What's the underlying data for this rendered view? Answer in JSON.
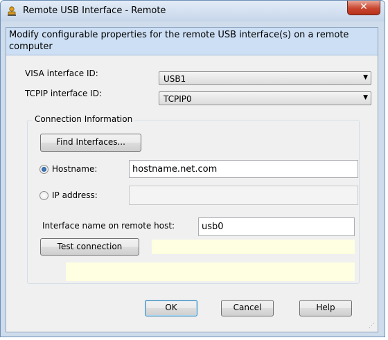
{
  "window": {
    "title": "Remote USB Interface - Remote",
    "close_symbol": "✕"
  },
  "banner": {
    "text": "Modify configurable properties for the remote USB interface(s) on a remote computer"
  },
  "visa": {
    "label": "VISA interface ID:",
    "value": "USB1"
  },
  "tcpip": {
    "label": "TCPIP interface ID:",
    "value": "TCPIP0"
  },
  "connection": {
    "group_label": "Connection Information",
    "find_button": "Find Interfaces...",
    "hostname_label": "Hostname:",
    "hostname_value": "hostname.net.com",
    "hostname_selected": true,
    "ip_label": "IP address:",
    "ip_value": "",
    "remote_name_label": "Interface name on remote host:",
    "remote_name_value": "usb0",
    "test_button": "Test connection"
  },
  "buttons": {
    "ok": "OK",
    "cancel": "Cancel",
    "help": "Help"
  },
  "icons": {
    "title_icon": "usb-person-icon",
    "dropdown_arrow": "▼"
  }
}
